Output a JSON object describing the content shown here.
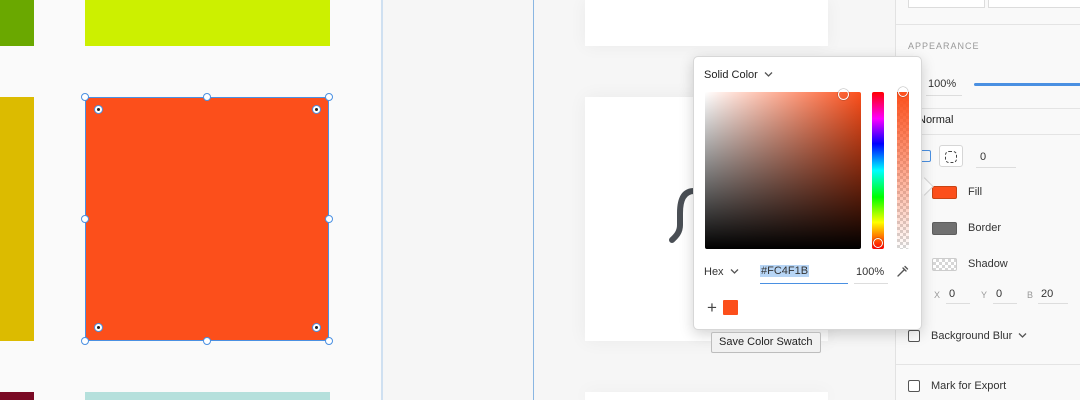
{
  "colors": {
    "selected_fill": "#FC4F1B",
    "green_swatch": "#6aa800",
    "lime_swatch": "#ccf000",
    "yellow_swatch": "#dcbb00",
    "maroon_swatch": "#7a0a24",
    "teal_swatch": "#b5e0dc",
    "selection_blue": "#4a90e2"
  },
  "inspector": {
    "appearance_heading": "APPEARANCE",
    "opacity_value": "100%",
    "blend_mode": "Normal",
    "corner_radius_value": "0",
    "fill_label": "Fill",
    "border_label": "Border",
    "shadow_label": "Shadow",
    "shadow_x_label": "X",
    "shadow_x_value": "0",
    "shadow_y_label": "Y",
    "shadow_y_value": "0",
    "shadow_b_label": "B",
    "shadow_b_value": "20",
    "background_blur_label": "Background Blur",
    "mark_for_export_label": "Mark for Export",
    "fill_color": "#FC4F1B",
    "border_color": "#707070"
  },
  "color_picker": {
    "fill_type": "Solid Color",
    "mode": "Hex",
    "hex_value": "#FC4F1B",
    "opacity_value": "100%",
    "add_swatch_symbol": "+",
    "saved_swatch_color": "#FC4F1B",
    "tooltip": "Save Color Swatch"
  }
}
